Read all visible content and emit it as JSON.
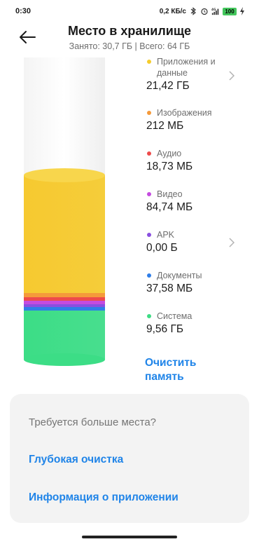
{
  "status_bar": {
    "time": "0:30",
    "speed": "0,2 КБ/с",
    "network": "4G",
    "battery": "100"
  },
  "header": {
    "title": "Место в хранилище",
    "subtitle": "Занято: 30,7 ГБ | Всего: 64 ГБ"
  },
  "categories": [
    {
      "name": "Приложения и данные",
      "size": "21,42 ГБ",
      "color": "#f5cc2c",
      "has_chevron": true
    },
    {
      "name": "Изображения",
      "size": "212 МБ",
      "color": "#f59a3a",
      "has_chevron": false
    },
    {
      "name": "Аудио",
      "size": "18,73 МБ",
      "color": "#ee4b4b",
      "has_chevron": false
    },
    {
      "name": "Видео",
      "size": "84,74 МБ",
      "color": "#c54be0",
      "has_chevron": false
    },
    {
      "name": "APK",
      "size": "0,00 Б",
      "color": "#8a4fe0",
      "has_chevron": true
    },
    {
      "name": "Документы",
      "size": "37,58 МБ",
      "color": "#2f7ee8",
      "has_chevron": false
    },
    {
      "name": "Система",
      "size": "9,56 ГБ",
      "color": "#3ddc84",
      "has_chevron": false
    }
  ],
  "clean_button": {
    "line1": "Очистить",
    "line2": "память"
  },
  "card": {
    "question": "Требуется больше места?",
    "deep_clean": "Глубокая очистка",
    "app_info": "Информация о приложении"
  }
}
